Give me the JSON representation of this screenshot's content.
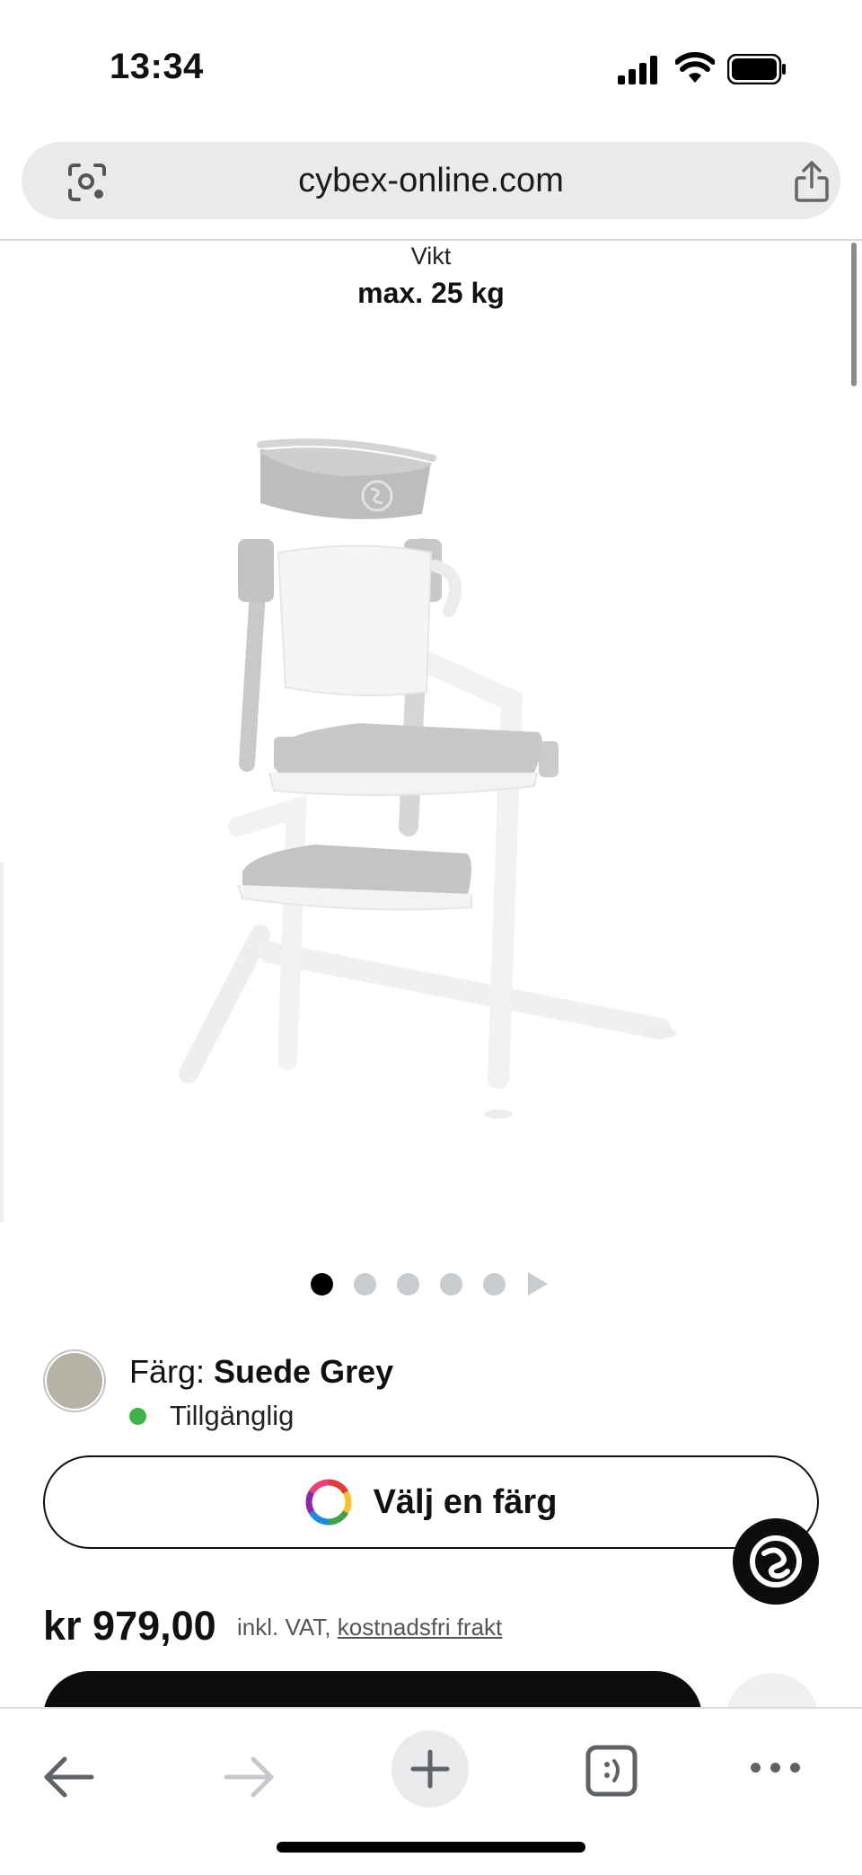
{
  "status_bar": {
    "time": "13:34"
  },
  "browser": {
    "url": "cybex-online.com"
  },
  "spec": {
    "label": "Vikt",
    "value": "max. 25 kg"
  },
  "gallery": {
    "total_slides": 5,
    "active_index": 0
  },
  "color": {
    "prefix": "Färg:",
    "name": "Suede Grey",
    "swatch_hex": "#b5b2a6",
    "availability": "Tillgänglig",
    "availability_color": "#3db34a"
  },
  "choose_color": {
    "label": "Välj en färg"
  },
  "price": {
    "amount": "kr 979,00",
    "vat_prefix": "inkl. VAT,",
    "shipping_link": "kostnadsfri frakt"
  },
  "icons": {
    "lens": "search-lens-icon",
    "share": "share-icon",
    "chat": "cybex-chat-icon",
    "back": "back-arrow-icon",
    "forward": "forward-arrow-icon",
    "new_tab": "plus-icon",
    "tabs": "tabs-icon",
    "more": "more-icon",
    "wishlist": "heart-icon"
  }
}
